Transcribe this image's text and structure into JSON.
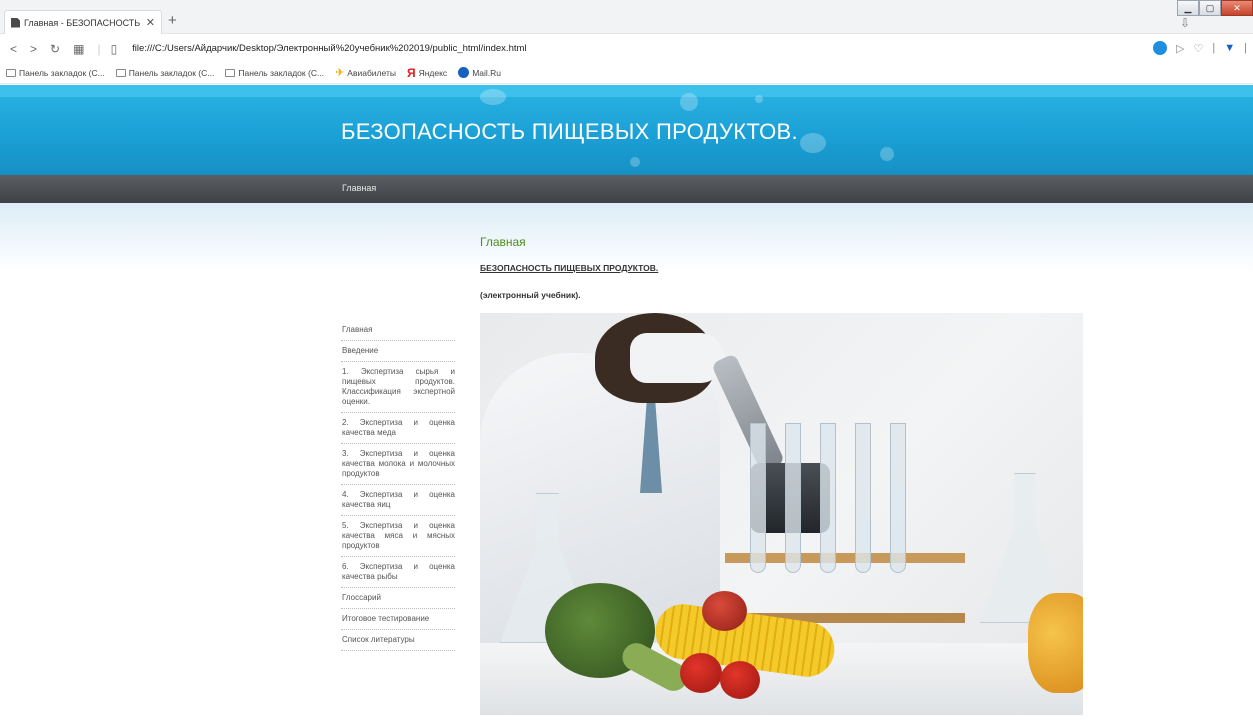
{
  "browser": {
    "tab_title": "Главная - БЕЗОПАСНОСТЬ П",
    "tab_close": "✕",
    "new_tab": "+",
    "url": "file:///C:/Users/Айдарчик/Desktop/Электронный%20учебник%202019/public_html/index.html",
    "bookmarks": [
      {
        "label": "Панель закладок (С...",
        "icon": "folder-icon"
      },
      {
        "label": "Панель закладок (С...",
        "icon": "folder-icon"
      },
      {
        "label": "Панель закладок (С...",
        "icon": "folder-icon"
      },
      {
        "label": "Авиабилеты",
        "icon": "plane-icon"
      },
      {
        "label": "Яндекс",
        "icon": "yandex-icon"
      },
      {
        "label": "Mail.Ru",
        "icon": "mail-icon"
      }
    ]
  },
  "site": {
    "banner_title": "БЕЗОПАСНОСТЬ ПИЩЕВЫХ ПРОДУКТОВ.",
    "nav_home": "Главная"
  },
  "content": {
    "heading": "Главная",
    "subtitle_link": "БЕЗОПАСНОСТЬ ПИЩЕВЫХ ПРОДУКТОВ.",
    "note": "(электронный учебник)."
  },
  "sidebar": {
    "items": [
      "Главная",
      "Введение",
      "1. Экспертиза сырья и пищевых продуктов. Классификация экспертной оценки.",
      "2. Экспертиза и оценка качества меда",
      "3. Экспертиза и оценка качества молока и молочных продуктов",
      "4. Экспертиза и оценка качества яиц",
      "5. Экспертиза и оценка качества мяса и мясных продуктов",
      "6. Экспертиза и оценка качества рыбы",
      "Глоссарий",
      "Итоговое тестирование",
      "Список литературы"
    ]
  },
  "colors": {
    "banner": "#1a9fd4",
    "navbar": "#4a4d52",
    "heading": "#4f8e1c"
  }
}
